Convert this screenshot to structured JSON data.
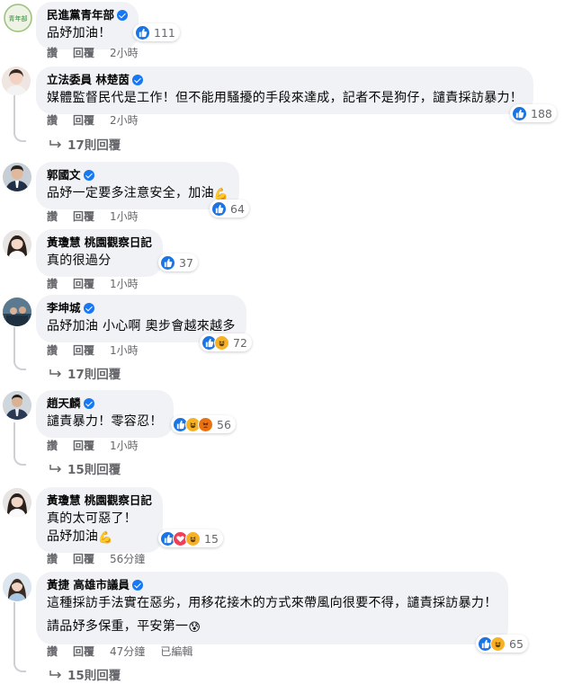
{
  "comments": [
    {
      "author": "民進黨青年部",
      "verified": true,
      "avatar_text": "青年部",
      "lines": [
        "品妤加油！"
      ],
      "reactions": [
        "like"
      ],
      "reaction_count": "111",
      "actions": {
        "like": "讚",
        "reply": "回覆",
        "time": "2小時"
      }
    },
    {
      "author": "立法委員 林楚茵",
      "verified": true,
      "lines": [
        "媒體監督民代是工作！但不能用騷擾的手段來達成，記者不是狗仔，譴責採訪暴力！"
      ],
      "reactions": [
        "like"
      ],
      "reaction_count": "188",
      "actions": {
        "like": "讚",
        "reply": "回覆",
        "time": "2小時"
      },
      "replies_label": "17則回覆"
    },
    {
      "author": "郭國文",
      "verified": true,
      "lines": [
        "品妤一定要多注意安全，加油"
      ],
      "line_emoji": "💪",
      "reactions": [
        "like"
      ],
      "reaction_count": "64",
      "actions": {
        "like": "讚",
        "reply": "回覆",
        "time": "1小時"
      }
    },
    {
      "author": "黃瓊慧 桃園觀察日記",
      "verified": false,
      "lines": [
        "真的很過分"
      ],
      "reactions": [
        "like"
      ],
      "reaction_count": "37",
      "actions": {
        "like": "讚",
        "reply": "回覆",
        "time": "1小時"
      }
    },
    {
      "author": "李坤城",
      "verified": true,
      "lines": [
        "品妤加油 小心啊 奧步會越來越多"
      ],
      "reactions": [
        "like",
        "haha"
      ],
      "reaction_count": "72",
      "actions": {
        "like": "讚",
        "reply": "回覆",
        "time": "1小時"
      },
      "replies_label": "17則回覆"
    },
    {
      "author": "趙天麟",
      "verified": true,
      "lines": [
        "譴責暴力！零容忍！"
      ],
      "reactions": [
        "like",
        "haha",
        "angry"
      ],
      "reaction_count": "56",
      "actions": {
        "like": "讚",
        "reply": "回覆",
        "time": "1小時"
      },
      "replies_label": "15則回覆"
    },
    {
      "author": "黃瓊慧 桃園觀察日記",
      "verified": false,
      "lines": [
        "真的太可惡了！",
        "品妤加油"
      ],
      "line_emoji": "💪",
      "reactions": [
        "like",
        "love",
        "haha"
      ],
      "reaction_count": "15",
      "actions": {
        "like": "讚",
        "reply": "回覆",
        "time": "56分鐘"
      }
    },
    {
      "author": "黃捷 高雄市議員",
      "verified": true,
      "lines": [
        "這種採訪手法實在惡劣，用移花接木的方式來帶風向很要不得，譴責採訪暴力！",
        "請品妤多保重，平安第一"
      ],
      "line_emoji": "😰",
      "reactions": [
        "like",
        "haha"
      ],
      "reaction_count": "65",
      "actions": {
        "like": "讚",
        "reply": "回覆",
        "time": "47分鐘",
        "edited": "已編輯"
      },
      "replies_label": "15則回覆"
    }
  ],
  "colors": {
    "bubble": "#f0f2f5",
    "meta_text": "#65676b",
    "like": "#1b74e4",
    "haha": "#f7b125",
    "angry": "#e9710f",
    "love": "#f33e58",
    "verified": "#1877f2"
  }
}
